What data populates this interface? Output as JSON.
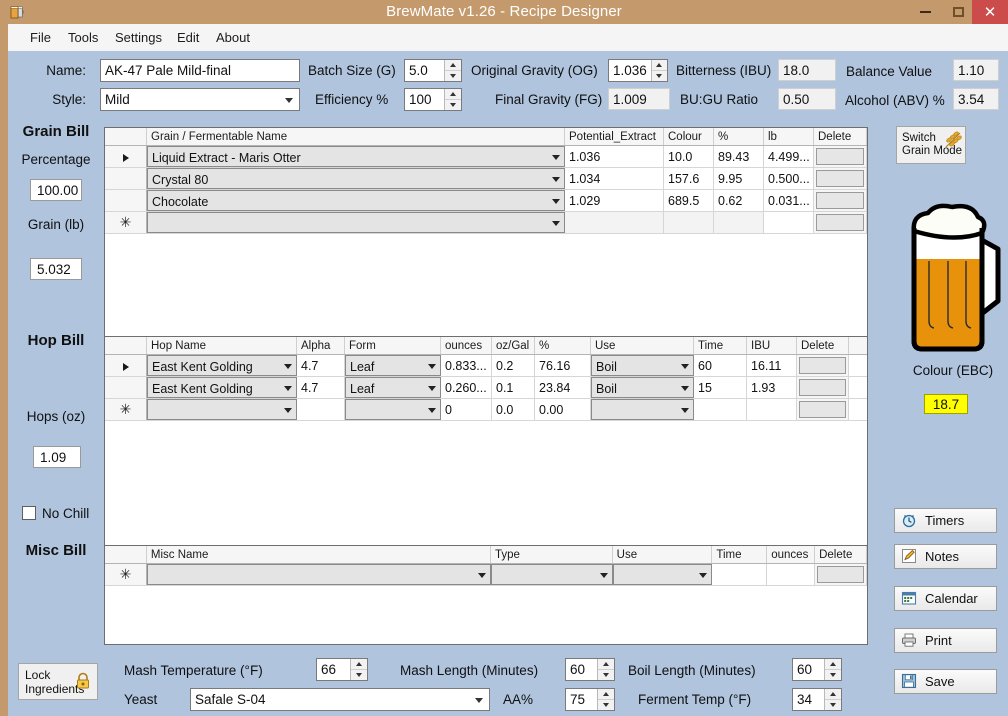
{
  "window": {
    "title": "BrewMate v1.26 - Recipe Designer",
    "icon": "beer-mug-icon",
    "minimize": "–",
    "maximize": "□",
    "close": "✕"
  },
  "menu": {
    "items": [
      "File",
      "Tools",
      "Settings",
      "Edit",
      "About"
    ]
  },
  "recipe": {
    "name_label": "Name:",
    "name_value": "AK-47 Pale Mild-final",
    "style_label": "Style:",
    "style_value": "Mild",
    "batch_size_label": "Batch Size (G)",
    "batch_size_value": "5.0",
    "efficiency_label": "Efficiency %",
    "efficiency_value": "100",
    "og_label": "Original Gravity (OG)",
    "og_value": "1.036",
    "fg_label": "Final Gravity (FG)",
    "fg_value": "1.009",
    "ibu_label": "Bitterness (IBU)",
    "ibu_value": "18.0",
    "bugu_label": "BU:GU Ratio",
    "bugu_value": "0.50",
    "balance_label": "Balance Value",
    "balance_value": "1.10",
    "abv_label": "Alcohol (ABV) %",
    "abv_value": "3.54"
  },
  "sidebar": {
    "grain_bill_title": "Grain Bill",
    "percentage_label": "Percentage",
    "percentage_value": "100.00",
    "grain_lb_label": "Grain (lb)",
    "grain_lb_value": "5.032",
    "hop_bill_title": "Hop Bill",
    "hops_oz_label": "Hops (oz)",
    "hops_oz_value": "1.09",
    "no_chill_label": "No Chill",
    "no_chill_checked": false,
    "misc_bill_title": "Misc Bill",
    "lock_ingredients_line1": "Lock",
    "lock_ingredients_line2": "Ingredients"
  },
  "grain_grid": {
    "columns": [
      "",
      "Grain / Fermentable Name",
      "Potential_Extract",
      "Colour",
      "%",
      "lb",
      "Delete"
    ],
    "rows": [
      {
        "marker": "current",
        "name": "Liquid Extract - Maris Otter",
        "potential_extract": "1.036",
        "colour": "10.0",
        "percent": "89.43",
        "lb": "4.499...",
        "delete": ""
      },
      {
        "marker": "",
        "name": "Crystal 80",
        "potential_extract": "1.034",
        "colour": "157.6",
        "percent": "9.95",
        "lb": "0.500...",
        "delete": ""
      },
      {
        "marker": "",
        "name": "Chocolate",
        "potential_extract": "1.029",
        "colour": "689.5",
        "percent": "0.62",
        "lb": "0.031...",
        "delete": ""
      },
      {
        "marker": "new",
        "name": "",
        "potential_extract": "",
        "colour": "",
        "percent": "",
        "lb": "",
        "delete": ""
      }
    ]
  },
  "hop_grid": {
    "columns": [
      "",
      "Hop Name",
      "Alpha",
      "Form",
      "ounces",
      "oz/Gal",
      "%",
      "Use",
      "Time",
      "IBU",
      "Delete"
    ],
    "rows": [
      {
        "marker": "current",
        "name": "East Kent Golding",
        "alpha": "4.7",
        "form": "Leaf",
        "ounces": "0.833...",
        "oz_gal": "0.2",
        "percent": "76.16",
        "use": "Boil",
        "time": "60",
        "ibu": "16.11",
        "delete": ""
      },
      {
        "marker": "",
        "name": "East Kent Golding",
        "alpha": "4.7",
        "form": "Leaf",
        "ounces": "0.260...",
        "oz_gal": "0.1",
        "percent": "23.84",
        "use": "Boil",
        "time": "15",
        "ibu": "1.93",
        "delete": ""
      },
      {
        "marker": "new",
        "name": "",
        "alpha": "",
        "form": "",
        "ounces": "0",
        "oz_gal": "0.0",
        "percent": "0.00",
        "use": "",
        "time": "",
        "ibu": "",
        "delete": ""
      }
    ]
  },
  "misc_grid": {
    "columns": [
      "",
      "Misc Name",
      "Type",
      "Use",
      "Time",
      "ounces",
      "Delete"
    ],
    "rows": [
      {
        "marker": "new",
        "name": "",
        "type": "",
        "use": "",
        "time": "",
        "ounces": "",
        "delete": ""
      }
    ]
  },
  "right_panel": {
    "switch_grain_mode_line1": "Switch",
    "switch_grain_mode_line2": "Grain Mode",
    "colour_label": "Colour (EBC)",
    "colour_value": "18.7",
    "buttons": [
      {
        "label": "Timers",
        "icon": "clock-icon"
      },
      {
        "label": "Notes",
        "icon": "pencil-icon"
      },
      {
        "label": "Calendar",
        "icon": "calendar-icon"
      },
      {
        "label": "Print",
        "icon": "printer-icon"
      },
      {
        "label": "Save",
        "icon": "floppy-disk-icon"
      }
    ]
  },
  "bottom": {
    "mash_temp_label": "Mash Temperature (°F)",
    "mash_temp_value": "66",
    "mash_length_label": "Mash Length (Minutes)",
    "mash_length_value": "60",
    "boil_length_label": "Boil Length (Minutes)",
    "boil_length_value": "60",
    "yeast_label": "Yeast",
    "yeast_value": "Safale S-04",
    "aa_label": "AA%",
    "aa_value": "75",
    "ferment_temp_label": "Ferment Temp (°F)",
    "ferment_temp_value": "34"
  },
  "colors": {
    "titlebar": "#c49a6c",
    "client": "#b0c4de",
    "close_button": "#cc4b4b",
    "highlight": "#ffff00",
    "beer_body": "#e8920c",
    "beer_foam": "#fdfdf7"
  }
}
